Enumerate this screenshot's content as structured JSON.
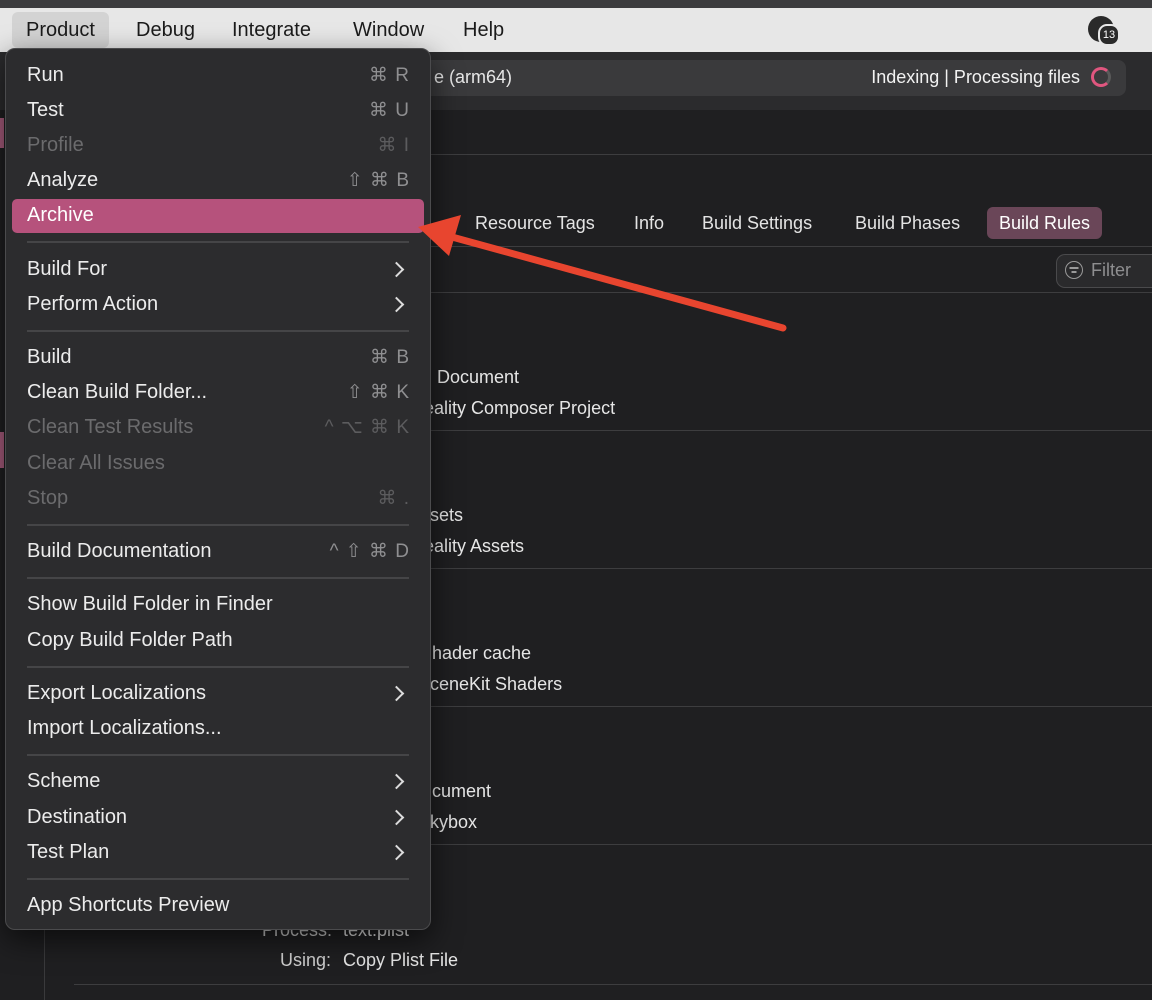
{
  "menubar": {
    "items": [
      "Product",
      "Debug",
      "Integrate",
      "Window",
      "Help"
    ],
    "badge_count": "13"
  },
  "toolbar": {
    "scheme_text": "e (arm64)",
    "status_text": "Indexing | Processing files"
  },
  "tabs": [
    "s",
    "Resource Tags",
    "Info",
    "Build Settings",
    "Build Phases",
    "Build Rules"
  ],
  "selected_tab": "Build Rules",
  "filter_placeholder": "Filter",
  "background_lines": [
    "Document",
    "eality Composer Project",
    "sets",
    "eality Assets",
    "hader cache",
    "ceneKit Shaders",
    "cument",
    "kybox",
    "Process:",
    "text.plist",
    "Using:",
    "Copy Plist File"
  ],
  "menu": {
    "items": [
      {
        "label": "Run",
        "shortcut": "⌘ R",
        "enabled": true
      },
      {
        "label": "Test",
        "shortcut": "⌘ U",
        "enabled": true
      },
      {
        "label": "Profile",
        "shortcut": "⌘ I",
        "enabled": false
      },
      {
        "label": "Analyze",
        "shortcut": "⇧ ⌘ B",
        "enabled": true
      },
      {
        "label": "Archive",
        "shortcut": "",
        "enabled": true,
        "highlighted": true
      },
      {
        "label": "Build For",
        "submenu": true
      },
      {
        "label": "Perform Action",
        "submenu": true
      },
      {
        "label": "Build",
        "shortcut": "⌘ B",
        "enabled": true
      },
      {
        "label": "Clean Build Folder...",
        "shortcut": "⇧ ⌘ K",
        "enabled": true
      },
      {
        "label": "Clean Test Results",
        "shortcut": "^ ⌥ ⌘ K",
        "enabled": false
      },
      {
        "label": "Clear All Issues",
        "shortcut": "",
        "enabled": false
      },
      {
        "label": "Stop",
        "shortcut": "⌘ .",
        "enabled": false
      },
      {
        "label": "Build Documentation",
        "shortcut": "^ ⇧ ⌘ D",
        "enabled": true
      },
      {
        "label": "Show Build Folder in Finder",
        "shortcut": "",
        "enabled": true
      },
      {
        "label": "Copy Build Folder Path",
        "shortcut": "",
        "enabled": true
      },
      {
        "label": "Export Localizations",
        "submenu": true
      },
      {
        "label": "Import Localizations...",
        "shortcut": "",
        "enabled": true
      },
      {
        "label": "Scheme",
        "submenu": true
      },
      {
        "label": "Destination",
        "submenu": true
      },
      {
        "label": "Test Plan",
        "submenu": true
      },
      {
        "label": "App Shortcuts Preview",
        "shortcut": "",
        "enabled": true
      }
    ]
  },
  "colors": {
    "highlight": "#b6527c",
    "selected_tab": "#6a4658",
    "annotation_arrow": "#e8452f"
  }
}
